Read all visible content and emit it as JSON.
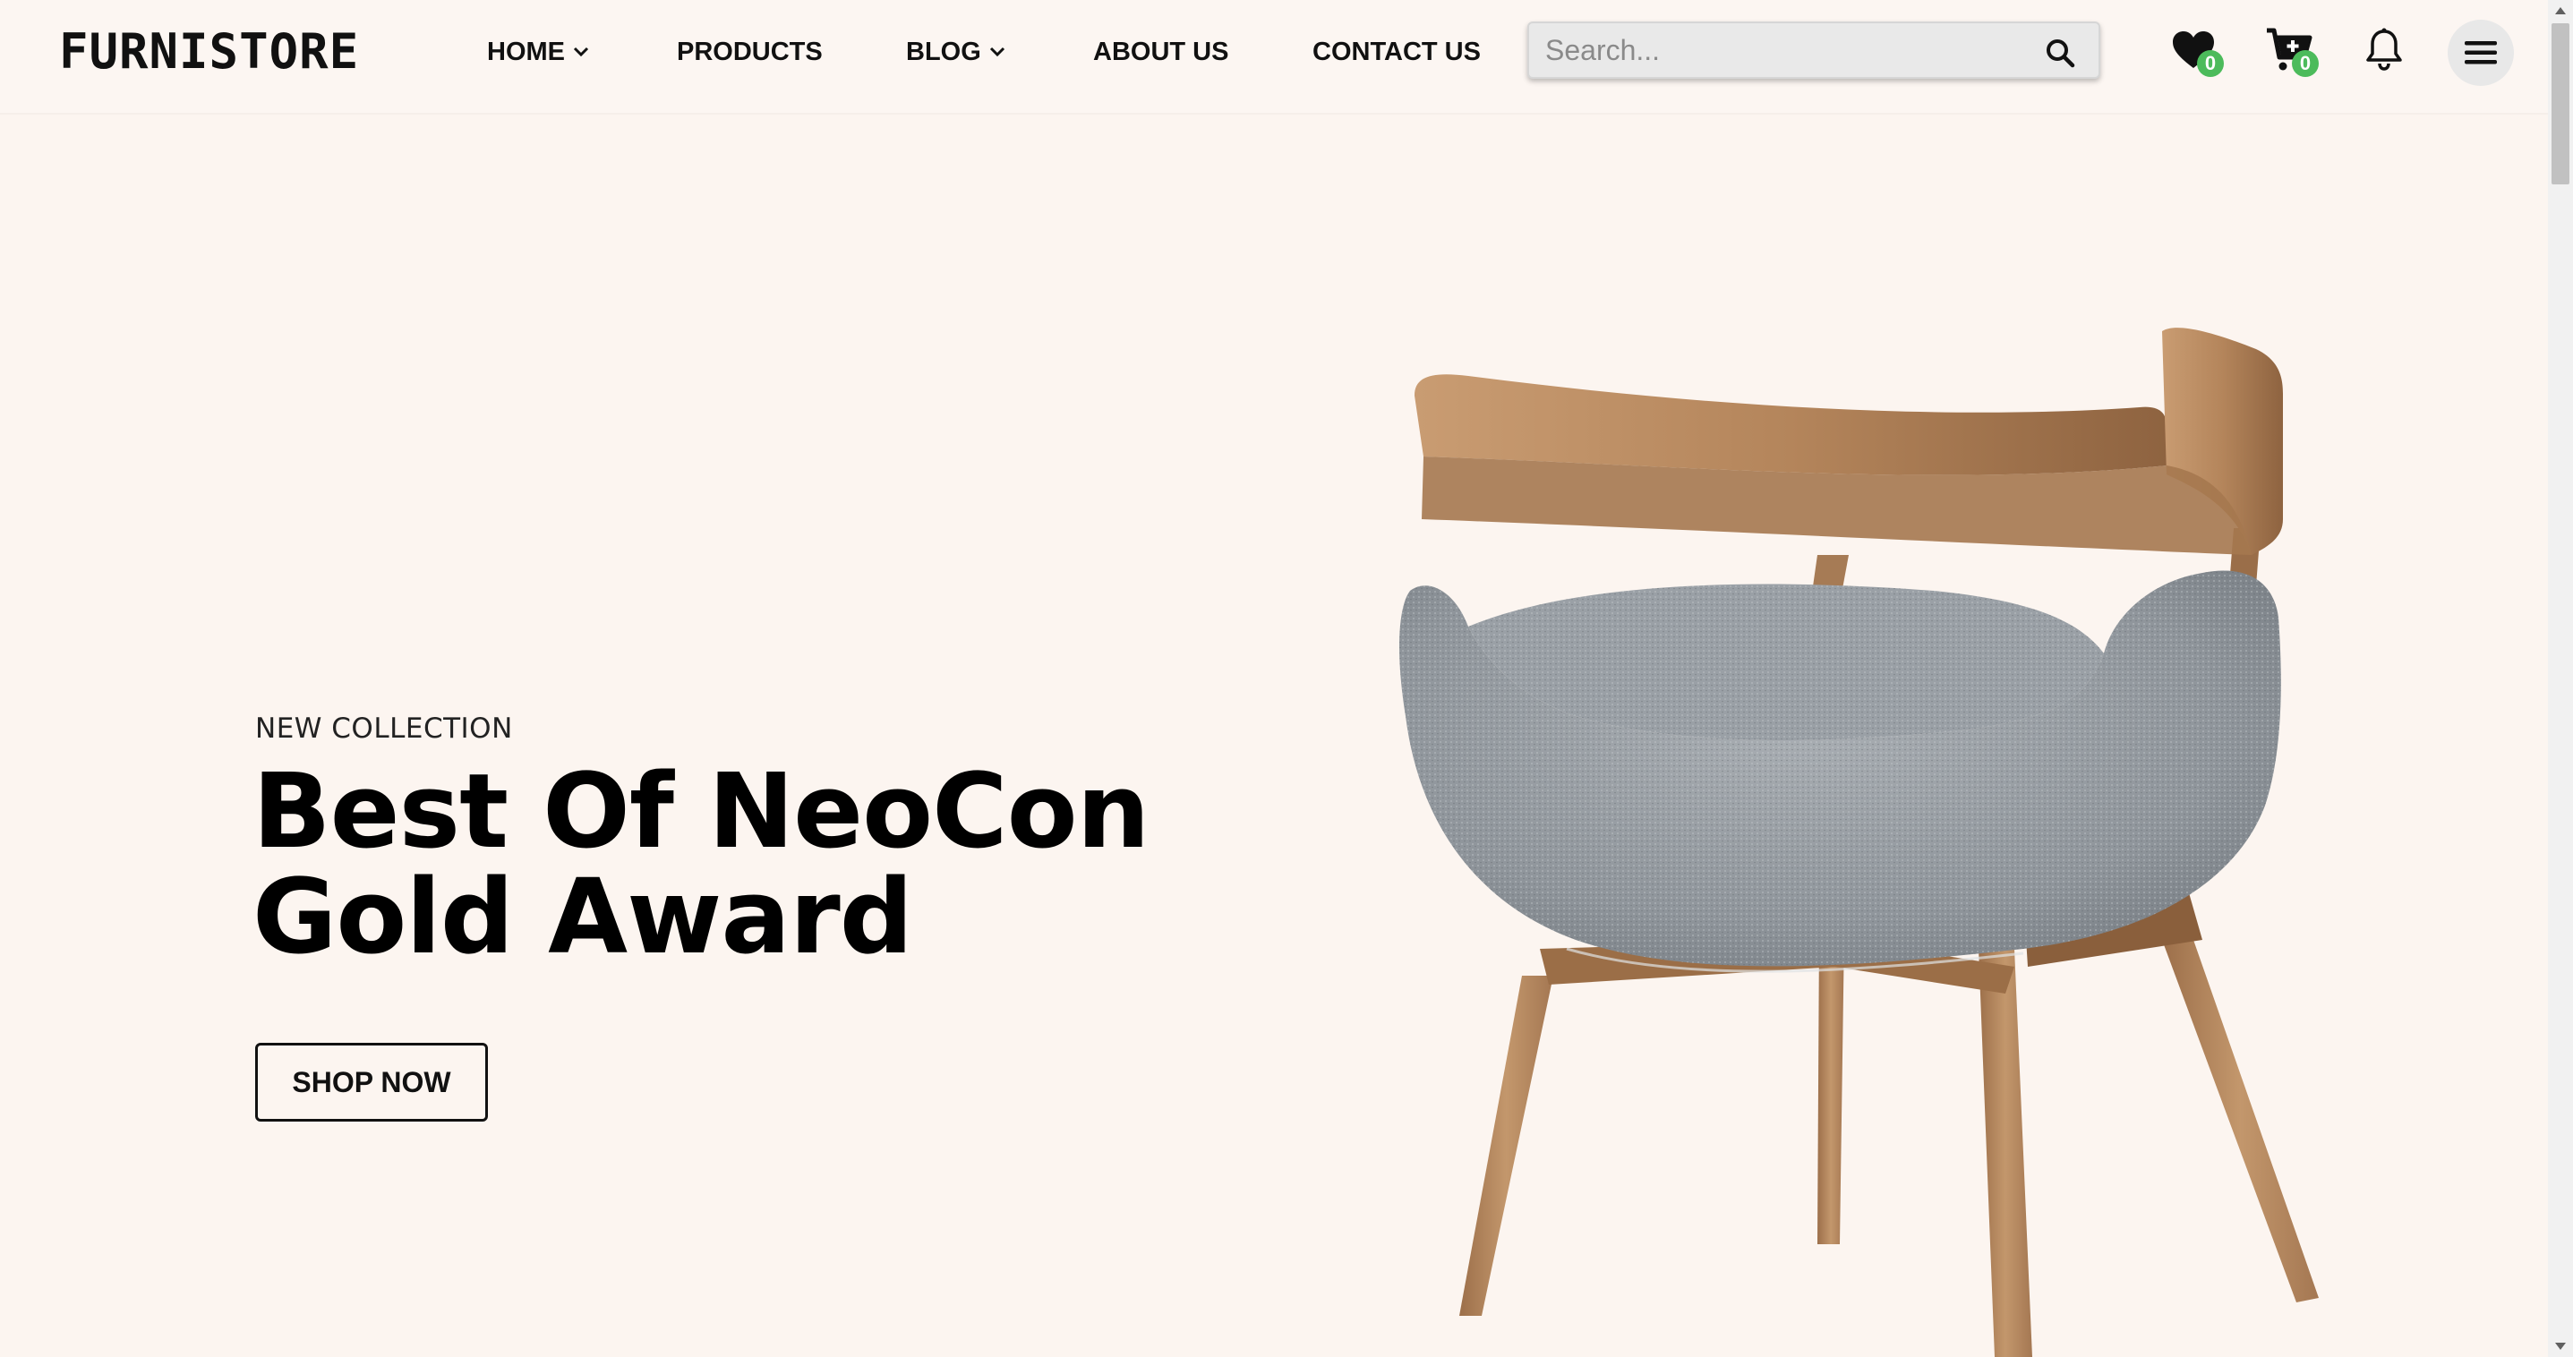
{
  "header": {
    "logo": "FURNISTORE",
    "nav": [
      {
        "label": "HOME",
        "has_dropdown": true
      },
      {
        "label": "PRODUCTS",
        "has_dropdown": false
      },
      {
        "label": "BLOG",
        "has_dropdown": true
      },
      {
        "label": "ABOUT US",
        "has_dropdown": false
      },
      {
        "label": "CONTACT US",
        "has_dropdown": false
      }
    ],
    "search": {
      "placeholder": "Search...",
      "value": "",
      "icon": "search-icon"
    },
    "wishlist": {
      "icon": "heart-icon",
      "count": "0"
    },
    "cart": {
      "icon": "cart-plus-icon",
      "count": "0"
    },
    "notifications": {
      "icon": "bell-icon"
    },
    "menu": {
      "icon": "hamburger-menu-icon"
    }
  },
  "hero": {
    "eyebrow": "NEW COLLECTION",
    "title_line1": "Best Of NeoCon",
    "title_line2": "Gold Award",
    "cta": "SHOP NOW",
    "image": "wooden-chair-grey-fabric-seat"
  },
  "colors": {
    "background": "#fcf5f0",
    "badge": "#4cbb5b",
    "text": "#000000",
    "wood": "#b78a62",
    "fabric": "#9ea3a8"
  }
}
